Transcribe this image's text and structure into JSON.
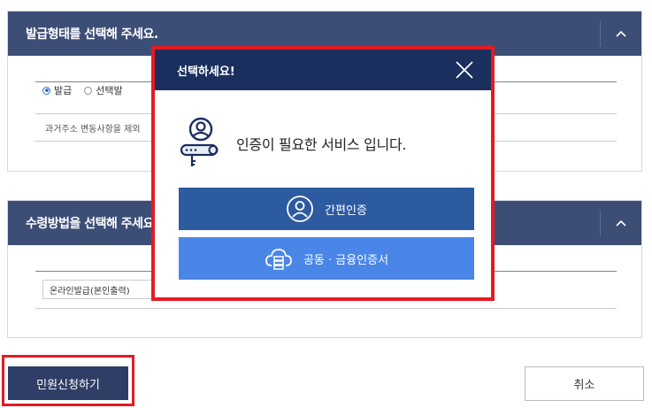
{
  "sections": {
    "issue_type": {
      "title": "발급형태를 선택해 주세요.",
      "options": [
        "발급",
        "선택발"
      ],
      "note": "과거주소 변동사항을 제외"
    },
    "receive_method": {
      "title": "수령방법을 선택해 주세요",
      "select_value": "온라인발급(본인출력)"
    }
  },
  "buttons": {
    "apply": "민원신청하기",
    "cancel": "취소"
  },
  "modal": {
    "title": "선택하세요!",
    "message": "인증이 필요한 서비스 입니다.",
    "simple_auth": "간편인증",
    "cert_auth": "공동 · 금융인증서"
  },
  "colors": {
    "section_header": "#3d4e76",
    "modal_header": "#1b2f5e",
    "simple_auth_button": "#2d5ba0",
    "cert_auth_button": "#4a86e8",
    "apply_button": "#2f3e66",
    "highlight": "#e41b23"
  },
  "icons": {
    "collapse": "chevron-up-icon",
    "close": "close-icon",
    "auth": "user-key-icon",
    "simple_auth": "user-circle-icon",
    "cert_auth": "cloud-server-icon"
  }
}
